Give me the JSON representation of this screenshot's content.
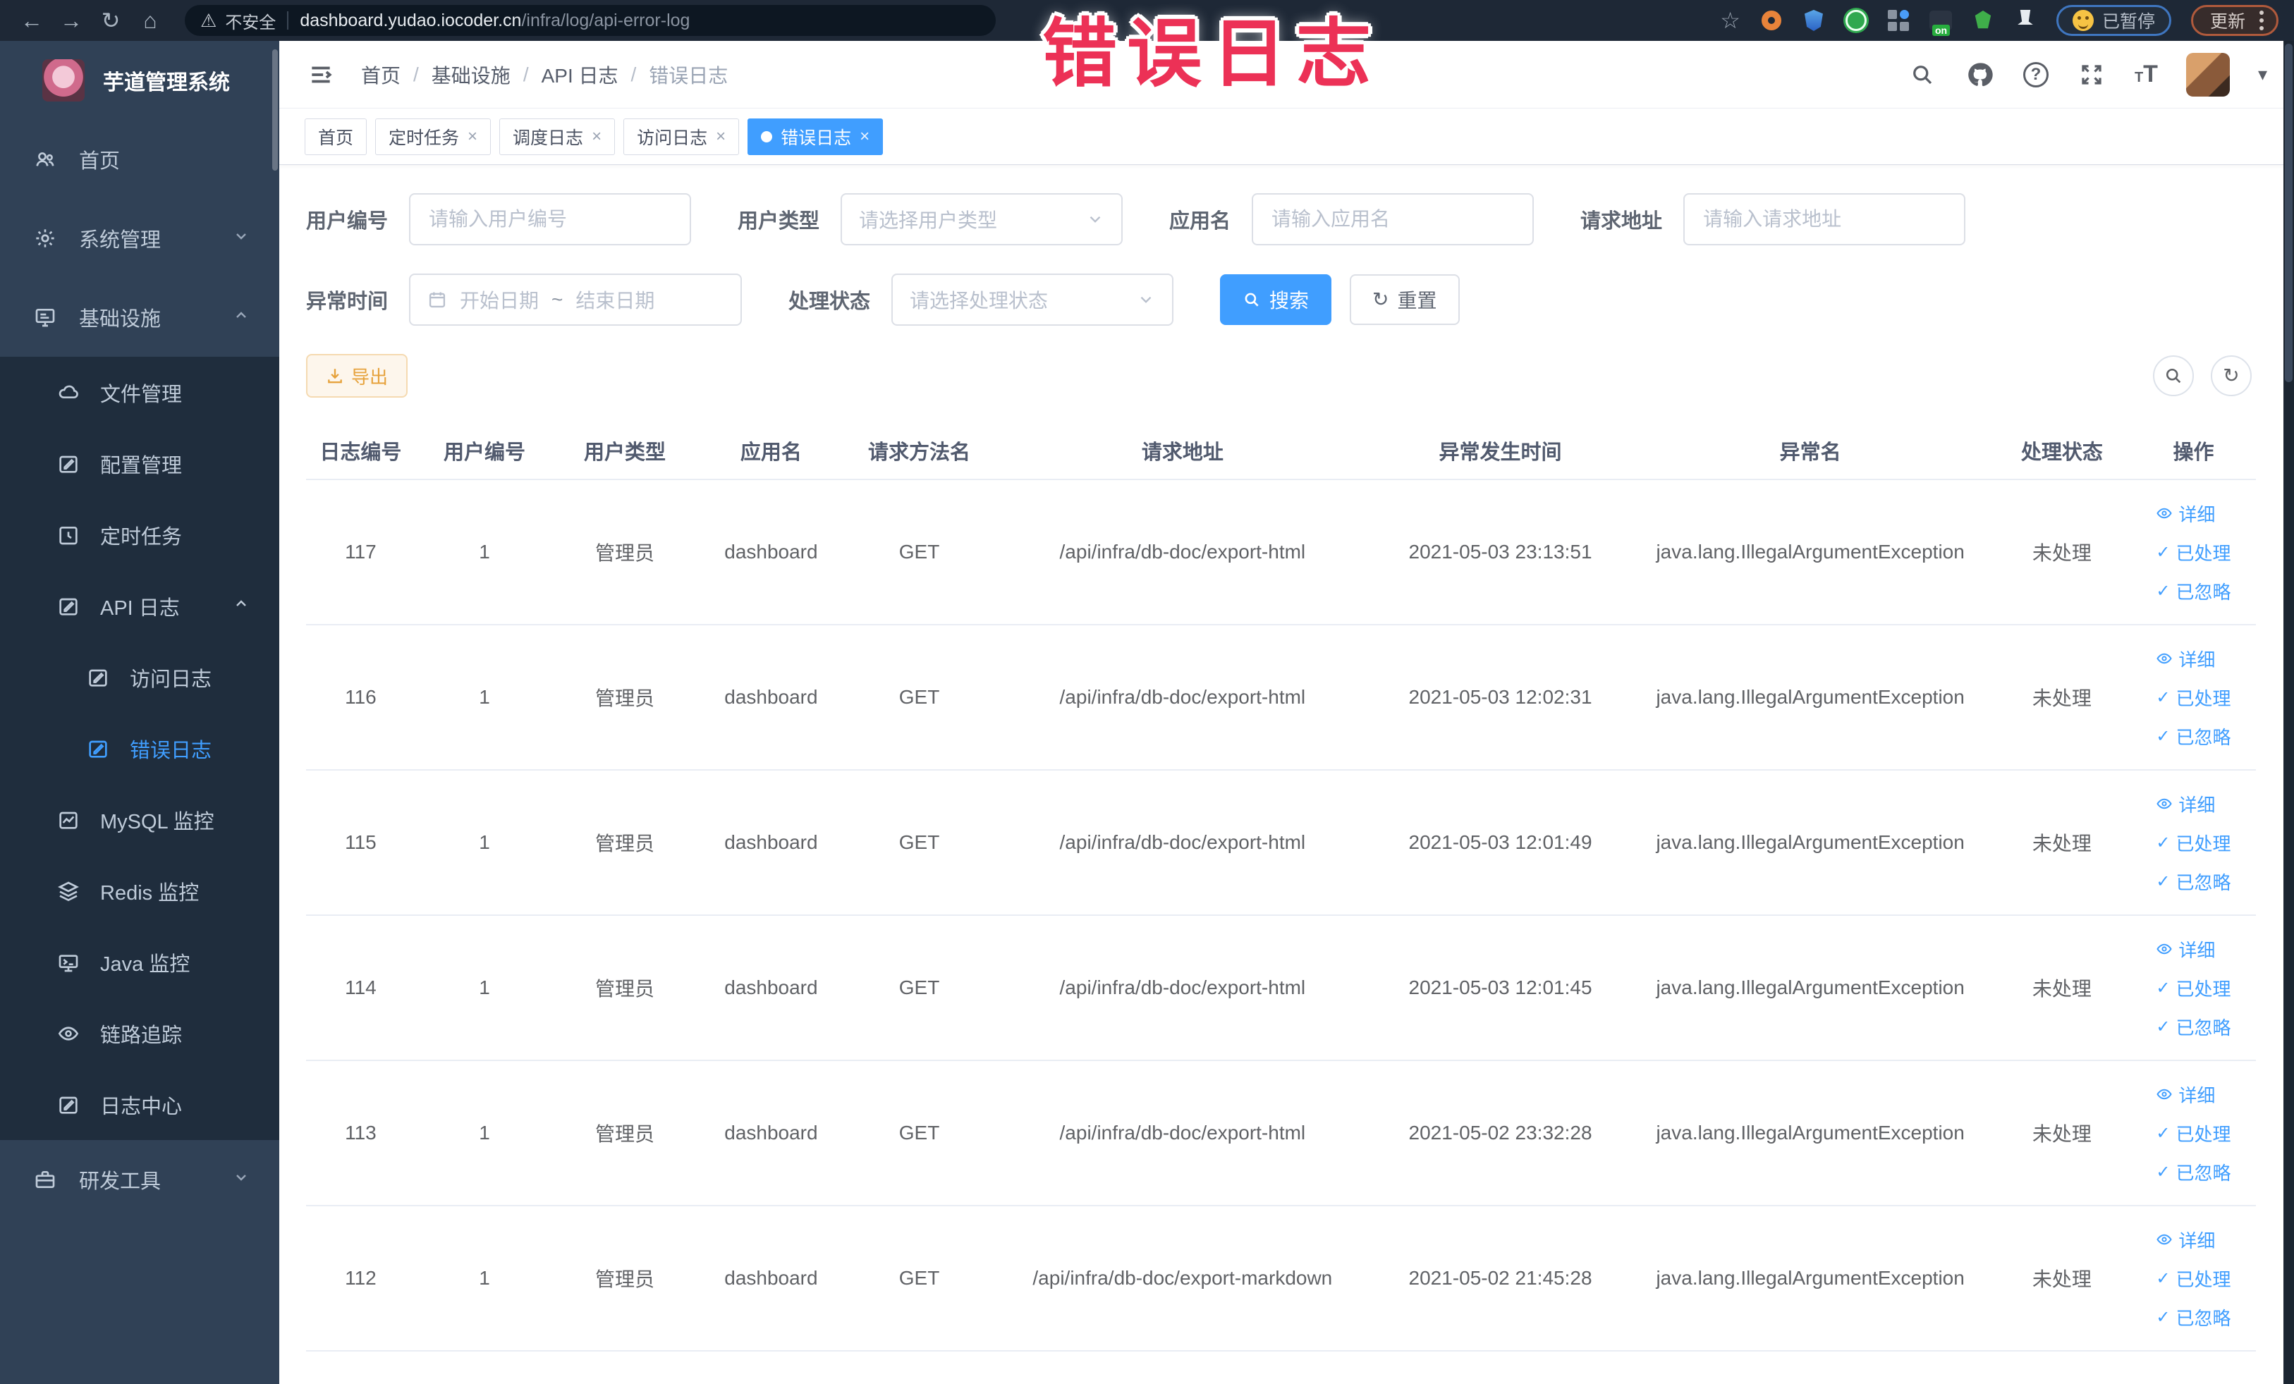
{
  "colors": {
    "accent": "#409EFF",
    "warning": "#E6A23C",
    "overlay_red": "#EC3156",
    "sidebar_bg": "#304156",
    "submenu_bg": "#1F2D3D",
    "chrome_bg": "#1E2836"
  },
  "icons": {
    "back": "←",
    "forward": "→",
    "reload": "↻",
    "home": "⌂",
    "warning": "⚠",
    "star": "☆",
    "caret": "▾",
    "check": "✓",
    "tilde": "~",
    "question": "?"
  },
  "browser": {
    "security_label": "不安全",
    "url_host": "dashboard.yudao.iocoder.cn",
    "url_path": "/infra/log/api-error-log",
    "on_badge": "on",
    "paused_label": "已暂停",
    "update_label": "更新"
  },
  "overlay_title": "错误日志",
  "sidebar": {
    "title": "芋道管理系统",
    "items": {
      "home": "首页",
      "system": "系统管理",
      "infra": "基础设施",
      "file": "文件管理",
      "config": "配置管理",
      "job": "定时任务",
      "apilog": "API 日志",
      "accesslog": "访问日志",
      "errorlog": "错误日志",
      "mysql": "MySQL 监控",
      "redis": "Redis 监控",
      "java": "Java 监控",
      "trace": "链路追踪",
      "logcenter": "日志中心",
      "devtools": "研发工具"
    }
  },
  "navbar": {
    "breadcrumb": [
      "首页",
      "基础设施",
      "API 日志",
      "错误日志"
    ],
    "separator": "/"
  },
  "tabs": [
    {
      "label": "首页"
    },
    {
      "label": "定时任务"
    },
    {
      "label": "调度日志"
    },
    {
      "label": "访问日志"
    },
    {
      "label": "错误日志"
    }
  ],
  "filters": {
    "user_id": {
      "label": "用户编号",
      "placeholder": "请输入用户编号"
    },
    "user_type": {
      "label": "用户类型",
      "placeholder": "请选择用户类型"
    },
    "app_name": {
      "label": "应用名",
      "placeholder": "请输入应用名"
    },
    "request_url": {
      "label": "请求地址",
      "placeholder": "请输入请求地址"
    },
    "exception_time": {
      "label": "异常时间",
      "start_placeholder": "开始日期",
      "end_placeholder": "结束日期"
    },
    "process_status": {
      "label": "处理状态",
      "placeholder": "请选择处理状态"
    },
    "search_label": "搜索",
    "reset_label": "重置"
  },
  "toolbar": {
    "export_label": "导出"
  },
  "table": {
    "headers": [
      "日志编号",
      "用户编号",
      "用户类型",
      "应用名",
      "请求方法名",
      "请求地址",
      "异常发生时间",
      "异常名",
      "处理状态",
      "操作"
    ],
    "actions": {
      "detail": "详细",
      "processed": "已处理",
      "ignored": "已忽略"
    },
    "rows": [
      {
        "log_id": "117",
        "user_id": "1",
        "user_type": "管理员",
        "app_name": "dashboard",
        "method": "GET",
        "url": "/api/infra/db-doc/export-html",
        "time": "2021-05-03 23:13:51",
        "exception": "java.lang.IllegalArgumentException",
        "status": "未处理"
      },
      {
        "log_id": "116",
        "user_id": "1",
        "user_type": "管理员",
        "app_name": "dashboard",
        "method": "GET",
        "url": "/api/infra/db-doc/export-html",
        "time": "2021-05-03 12:02:31",
        "exception": "java.lang.IllegalArgumentException",
        "status": "未处理"
      },
      {
        "log_id": "115",
        "user_id": "1",
        "user_type": "管理员",
        "app_name": "dashboard",
        "method": "GET",
        "url": "/api/infra/db-doc/export-html",
        "time": "2021-05-03 12:01:49",
        "exception": "java.lang.IllegalArgumentException",
        "status": "未处理"
      },
      {
        "log_id": "114",
        "user_id": "1",
        "user_type": "管理员",
        "app_name": "dashboard",
        "method": "GET",
        "url": "/api/infra/db-doc/export-html",
        "time": "2021-05-03 12:01:45",
        "exception": "java.lang.IllegalArgumentException",
        "status": "未处理"
      },
      {
        "log_id": "113",
        "user_id": "1",
        "user_type": "管理员",
        "app_name": "dashboard",
        "method": "GET",
        "url": "/api/infra/db-doc/export-html",
        "time": "2021-05-02 23:32:28",
        "exception": "java.lang.IllegalArgumentException",
        "status": "未处理"
      },
      {
        "log_id": "112",
        "user_id": "1",
        "user_type": "管理员",
        "app_name": "dashboard",
        "method": "GET",
        "url": "/api/infra/db-doc/export-markdown",
        "time": "2021-05-02 21:45:28",
        "exception": "java.lang.IllegalArgumentException",
        "status": "未处理"
      }
    ]
  }
}
